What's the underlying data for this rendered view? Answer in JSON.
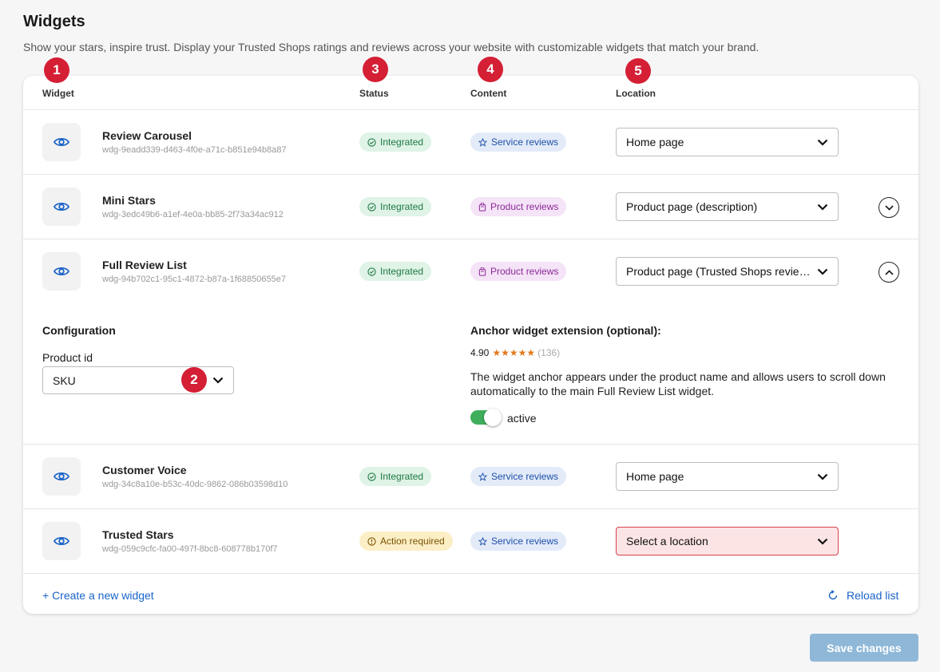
{
  "page": {
    "title": "Widgets",
    "subtitle": "Show your stars, inspire trust. Display your Trusted Shops ratings and reviews across your website with customizable widgets that match your brand."
  },
  "markers": [
    "1",
    "2",
    "3",
    "4",
    "5"
  ],
  "columns": {
    "widget": "Widget",
    "status": "Status",
    "content": "Content",
    "location": "Location"
  },
  "widgets": [
    {
      "name": "Review Carousel",
      "id": "wdg-9eadd339-d463-4f0e-a71c-b851e94b8a87",
      "status": "Integrated",
      "content": "Service reviews",
      "location": "Home page"
    },
    {
      "name": "Mini Stars",
      "id": "wdg-3edc49b6-a1ef-4e0a-bb85-2f73a34ac912",
      "status": "Integrated",
      "content": "Product reviews",
      "location": "Product page (description)"
    },
    {
      "name": "Full Review List",
      "id": "wdg-94b702c1-95c1-4872-b87a-1f68850655e7",
      "status": "Integrated",
      "content": "Product reviews",
      "location": "Product page (Trusted Shops reviews tab)"
    },
    {
      "name": "Customer Voice",
      "id": "wdg-34c8a10e-b53c-40dc-9862-086b03598d10",
      "status": "Integrated",
      "content": "Service reviews",
      "location": "Home page"
    },
    {
      "name": "Trusted Stars",
      "id": "wdg-059c9cfc-fa00-497f-8bc8-608778b170f7",
      "status": "Action required",
      "content": "Service reviews",
      "location": "Select a location"
    }
  ],
  "config": {
    "title": "Configuration",
    "product_id_label": "Product id",
    "product_id_value": "SKU",
    "anchor_title": "Anchor widget extension (optional):",
    "rating": "4.90",
    "stars": "★★★★★",
    "review_count": "(136)",
    "anchor_desc": "The widget anchor appears under the product name and allows users to scroll down automatically to the main Full Review List widget.",
    "toggle_label": "active",
    "toggle_on": true
  },
  "footer": {
    "create": "+ Create a new widget",
    "reload": "Reload list"
  },
  "save_button": "Save changes",
  "colors": {
    "marker": "#d41f35",
    "link": "#1a63c8",
    "toggle_on": "#3fae5c",
    "save_disabled": "#8fb8d8"
  }
}
